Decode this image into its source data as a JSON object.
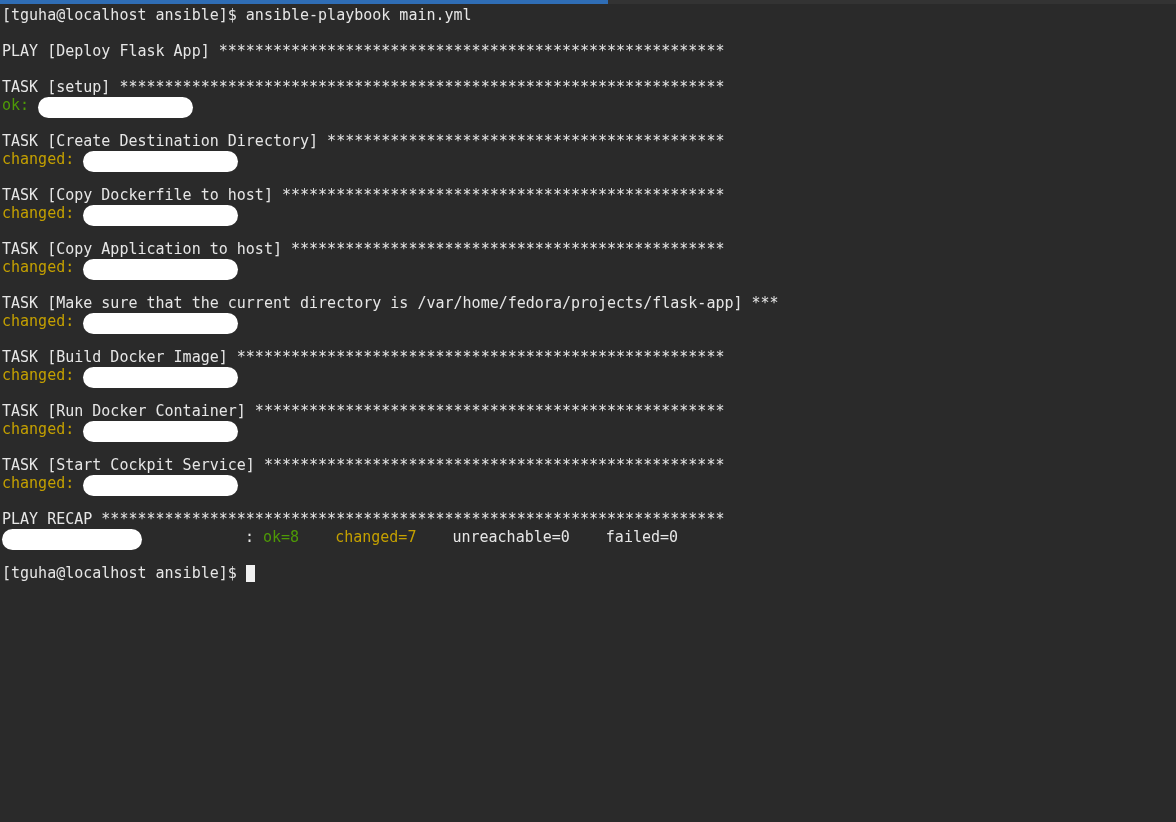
{
  "prompt": "[tguha@localhost ansible]$ ansible-playbook main.yml",
  "play": {
    "header": "PLAY [Deploy Flask App] ********************************************************"
  },
  "tasks": [
    {
      "header": "TASK [setup] *******************************************************************",
      "result": {
        "color": "#4e9a06",
        "label": "ok:"
      }
    },
    {
      "header": "TASK [Create Destination Directory] ********************************************",
      "result": {
        "color": "#c4a000",
        "label": "changed:"
      }
    },
    {
      "header": "TASK [Copy Dockerfile to host] *************************************************",
      "result": {
        "color": "#c4a000",
        "label": "changed:"
      }
    },
    {
      "header": "TASK [Copy Application to host] ************************************************",
      "result": {
        "color": "#c4a000",
        "label": "changed:"
      }
    },
    {
      "header": "TASK [Make sure that the current directory is /var/home/fedora/projects/flask-app] ***",
      "result": {
        "color": "#c4a000",
        "label": "changed:"
      }
    },
    {
      "header": "TASK [Build Docker Image] ******************************************************",
      "result": {
        "color": "#c4a000",
        "label": "changed:"
      }
    },
    {
      "header": "TASK [Run Docker Container] ****************************************************",
      "result": {
        "color": "#c4a000",
        "label": "changed:"
      }
    },
    {
      "header": "TASK [Start Cockpit Service] ***************************************************",
      "result": {
        "color": "#c4a000",
        "label": "changed:"
      }
    }
  ],
  "recap": {
    "header": "PLAY RECAP *********************************************************************",
    "separator": ":",
    "stats": [
      {
        "text": "ok=8",
        "color": "#4e9a06"
      },
      {
        "text": "changed=7",
        "color": "#c4a000"
      },
      {
        "text": "unreachable=0",
        "color": "#e6e6e6"
      },
      {
        "text": "failed=0",
        "color": "#e6e6e6"
      }
    ]
  },
  "final_prompt": "[tguha@localhost ansible]$"
}
